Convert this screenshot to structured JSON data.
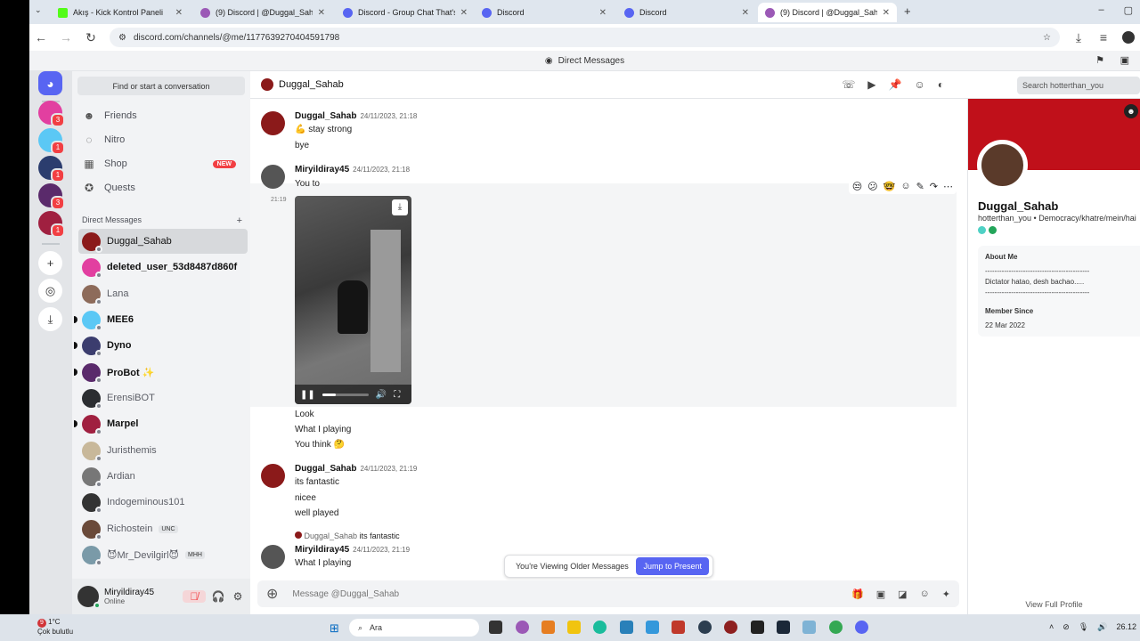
{
  "browser": {
    "tabs": [
      {
        "title": "Akış - Kick Kontrol Paneli"
      },
      {
        "title": "(9) Discord | @Duggal_Sahab"
      },
      {
        "title": "Discord - Group Chat That's All"
      },
      {
        "title": "Discord"
      },
      {
        "title": "Discord"
      },
      {
        "title": "(9) Discord | @Duggal_Sahab"
      }
    ],
    "url": "discord.com/channels/@me/1177639270404591798"
  },
  "app": {
    "top_title": "Direct Messages",
    "server_badges": [
      "3",
      "1",
      "1",
      "3",
      "1"
    ]
  },
  "sidebar": {
    "search": "Find or start a conversation",
    "nav": [
      {
        "label": "Friends",
        "icon": "friends-icon"
      },
      {
        "label": "Nitro",
        "icon": "nitro-icon"
      },
      {
        "label": "Shop",
        "icon": "shop-icon",
        "badge": "NEW"
      },
      {
        "label": "Quests",
        "icon": "quests-icon"
      }
    ],
    "dm_header": "Direct Messages",
    "dms": [
      {
        "name": "Duggal_Sahab",
        "color": "#8b1a1a"
      },
      {
        "name": "deleted_user_53d8487d860f",
        "color": "#e23fa0"
      },
      {
        "name": "Lana",
        "color": "#8d6b5a"
      },
      {
        "name": "MEE6",
        "color": "#5bc8f5"
      },
      {
        "name": "Dyno",
        "color": "#3b3d6e"
      },
      {
        "name": "ProBot ✨",
        "color": "#5a2a6b"
      },
      {
        "name": "ErensiBOT",
        "color": "#2b2d31"
      },
      {
        "name": "Marpel",
        "color": "#a02040"
      },
      {
        "name": "Juristhemis",
        "color": "#c8b89a"
      },
      {
        "name": "Ardian",
        "color": "#777777"
      },
      {
        "name": "Indogeminous101",
        "color": "#333333"
      },
      {
        "name": "Richostein",
        "color": "#6a4a3a",
        "tag": "UNC"
      },
      {
        "name": "😈Mr_Devilgirl😈",
        "color": "#7a9aa8",
        "tag": "MHH"
      }
    ],
    "user": {
      "name": "Miryildiray45",
      "status": "Online"
    }
  },
  "chat": {
    "recipient": "Duggal_Sahab",
    "search_placeholder": "Search hotterthan_you",
    "messages": [
      {
        "author": "Duggal_Sahab",
        "time": "24/11/2023, 21:18",
        "lines": [
          "💪 stay strong",
          "bye"
        ]
      },
      {
        "author": "Miryildiray45",
        "time": "24/11/2023, 21:18",
        "lines": [
          "You to"
        ]
      },
      {
        "side_time": "21:19",
        "lines": [
          "Look",
          "What I playing",
          "You think 🤔"
        ]
      },
      {
        "author": "Duggal_Sahab",
        "time": "24/11/2023, 21:19",
        "lines": [
          "its fantastic",
          "nicee",
          "well played"
        ]
      },
      {
        "reply_author": "Duggal_Sahab",
        "reply_text": "its fantastic",
        "author": "Miryildiray45",
        "time": "24/11/2023, 21:19",
        "lines": [
          "What I playing"
        ]
      }
    ],
    "video_progress": 0.3,
    "older_notice": "You're Viewing Older Messages",
    "jump_button": "Jump to Present",
    "composer_placeholder": "Message @Duggal_Sahab"
  },
  "profile": {
    "name": "Duggal_Sahab",
    "handle": "hotterthan_you • Democracy/khatre/mein/hai",
    "about_title": "About Me",
    "about_lines": [
      "--------------------------------------------",
      "Dictator hatao, desh bachao.....",
      "--------------------------------------------"
    ],
    "member_since_title": "Member Since",
    "member_since": "22 Mar 2022",
    "view_full": "View Full Profile",
    "banner_color": "#c0101a"
  },
  "taskbar": {
    "weather_temp": "1°C",
    "weather_desc": "Çok bulutlu",
    "weather_badge": "9",
    "search": "Ara",
    "clock": "26.12"
  }
}
